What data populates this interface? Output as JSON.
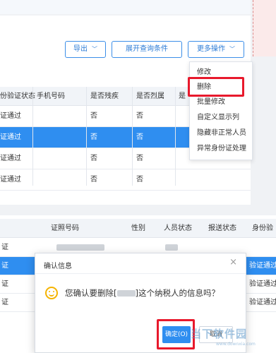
{
  "toolbar": {
    "export_label": "导出",
    "expand_label": "展开查询条件",
    "more_label": "更多操作"
  },
  "more_menu": {
    "items": [
      "修改",
      "删除",
      "批量修改",
      "自定义显示列",
      "隐藏非正常人员",
      "异常身份证处理"
    ]
  },
  "upper_table": {
    "headers": [
      "份验证状态",
      "手机号码",
      "是否残疾",
      "是否烈属",
      "是"
    ],
    "rows": [
      {
        "status": "证通过",
        "disabled": "否",
        "martyr": "否",
        "extra": "否",
        "selected": false
      },
      {
        "status": "证通过",
        "disabled": "否",
        "martyr": "否",
        "extra": "否",
        "selected": true
      },
      {
        "status": "证通过",
        "disabled": "否",
        "martyr": "否",
        "extra": "否",
        "selected": false
      },
      {
        "status": "证通过",
        "disabled": "否",
        "martyr": "否",
        "extra": "否",
        "selected": false
      }
    ]
  },
  "lower_table": {
    "headers": [
      "证照号码",
      "性别",
      "人员状态",
      "报送状态",
      "身份验"
    ],
    "rows": [
      {
        "left": "证",
        "right": "",
        "selected": false
      },
      {
        "left": "证",
        "right": "验证通过",
        "selected": true
      },
      {
        "left": "证",
        "right": "验证通过",
        "selected": false
      },
      {
        "left": "证",
        "right": "验证通过",
        "selected": false
      }
    ]
  },
  "dialog": {
    "title": "确认信息",
    "close_glyph": "×",
    "message_prefix": "您确认要删除[",
    "message_suffix": "]这个纳税人的信息吗？",
    "ok_label": "确定(O)",
    "cancel_label": "取消"
  },
  "watermark": {
    "name": "当下软件园",
    "url": "www.downxia.com"
  }
}
